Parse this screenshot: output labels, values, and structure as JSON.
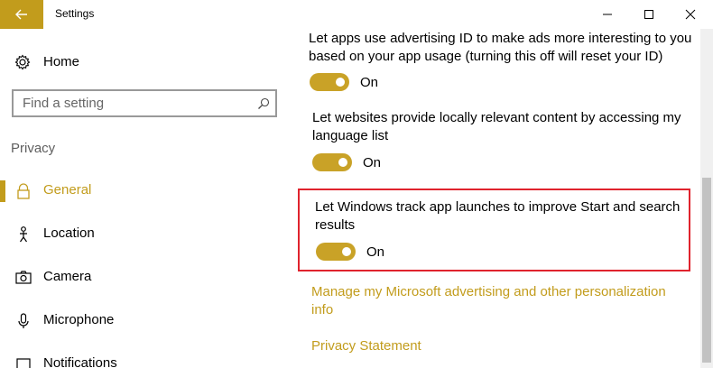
{
  "window": {
    "title": "Settings"
  },
  "sidebar": {
    "home_label": "Home",
    "search_placeholder": "Find a setting",
    "section": "Privacy",
    "items": [
      {
        "label": "General",
        "icon": "lock-icon",
        "active": true
      },
      {
        "label": "Location",
        "icon": "person-location-icon",
        "active": false
      },
      {
        "label": "Camera",
        "icon": "camera-icon",
        "active": false
      },
      {
        "label": "Microphone",
        "icon": "microphone-icon",
        "active": false
      },
      {
        "label": "Notifications",
        "icon": "notification-icon",
        "active": false
      }
    ]
  },
  "settings": [
    {
      "description": "Let apps use advertising ID to make ads more interesting to you based on your app usage (turning this off will reset your ID)",
      "state": "On"
    },
    {
      "description": "Let websites provide locally relevant content by accessing my language list",
      "state": "On"
    },
    {
      "description": "Let Windows track app launches to improve Start and search results",
      "state": "On"
    }
  ],
  "links": {
    "advertising": "Manage my Microsoft advertising and other personalization info",
    "privacy_statement": "Privacy Statement"
  },
  "colors": {
    "accent": "#c29c1c",
    "highlight": "#e0232d"
  }
}
